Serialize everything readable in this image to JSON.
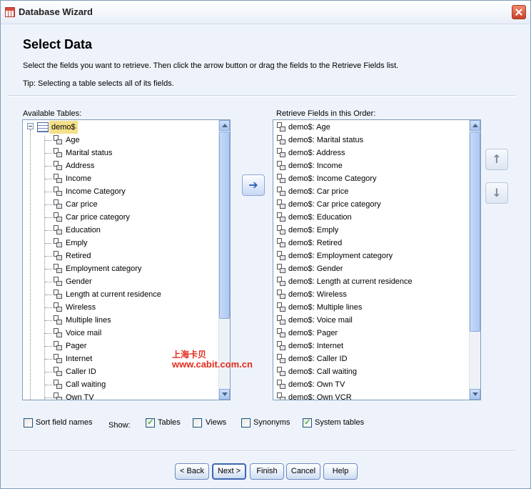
{
  "window": {
    "title": "Database Wizard"
  },
  "page": {
    "heading": "Select Data",
    "instructions": "Select the fields you want to retrieve. Then click the arrow button or drag the fields to the Retrieve Fields list.",
    "tip": "Tip: Selecting a table selects all of its fields."
  },
  "available": {
    "label": "Available Tables:",
    "table": "demo$",
    "fields": [
      "Age",
      "Marital status",
      "Address",
      "Income",
      "Income Category",
      "Car price",
      "Car price category",
      "Education",
      "Emply",
      "Retired",
      "Employment category",
      "Gender",
      "Length at current residence",
      "Wireless",
      "Multiple lines",
      "Voice mail",
      "Pager",
      "Internet",
      "Caller ID",
      "Call waiting",
      "Own TV"
    ]
  },
  "retrieve": {
    "label": "Retrieve Fields in this Order:",
    "fields": [
      "demo$: Age",
      "demo$: Marital status",
      "demo$: Address",
      "demo$: Income",
      "demo$: Income Category",
      "demo$: Car price",
      "demo$: Car price category",
      "demo$: Education",
      "demo$: Emply",
      "demo$: Retired",
      "demo$: Employment category",
      "demo$: Gender",
      "demo$: Length at current residence",
      "demo$: Wireless",
      "demo$: Multiple lines",
      "demo$: Voice mail",
      "demo$: Pager",
      "demo$: Internet",
      "demo$: Caller ID",
      "demo$: Call waiting",
      "demo$: Own TV",
      "demo$: Own  VCR"
    ]
  },
  "options": {
    "sort_label": "Sort field names",
    "sort_checked": false,
    "show_label": "Show:",
    "tables_label": "Tables",
    "tables_checked": true,
    "views_label": "Views",
    "views_checked": false,
    "synonyms_label": "Synonyms",
    "synonyms_checked": false,
    "system_tables_label": "System tables",
    "system_tables_checked": true
  },
  "buttons": {
    "back": "< Back",
    "next": "Next >",
    "finish": "Finish",
    "cancel": "Cancel",
    "help": "Help"
  },
  "watermark": {
    "line1": "上海卡贝",
    "line2": "www.cabit.com.cn"
  },
  "icons": {
    "app": "database-wizard-icon",
    "close": "close-icon",
    "move_right": "arrow-right-icon",
    "move_up": "arrow-up-icon",
    "move_down": "arrow-down-icon",
    "field": "field-icon",
    "table": "table-icon"
  }
}
